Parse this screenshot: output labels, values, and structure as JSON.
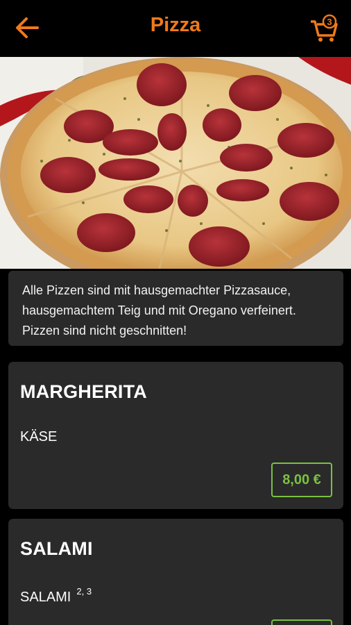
{
  "header": {
    "title": "Pizza",
    "cart_count": "3",
    "accent_color": "#f07a1a"
  },
  "hero": {
    "image": "pepperoni-pizza-photo"
  },
  "info": {
    "text": "Alle Pizzen sind mit hausgemachter Pizzasauce, hausgemachtem Teig und mit Oregano verfeinert. Pizzen sind nicht geschnitten!"
  },
  "items": [
    {
      "name": "MARGHERITA",
      "description": "KÄSE",
      "allergens": "",
      "price": "8,00 €"
    },
    {
      "name": "SALAMI",
      "description": "SALAMI",
      "allergens": "2, 3",
      "price": ""
    }
  ],
  "colors": {
    "price_border": "#7bc142",
    "card_bg": "#2a2a2a"
  }
}
